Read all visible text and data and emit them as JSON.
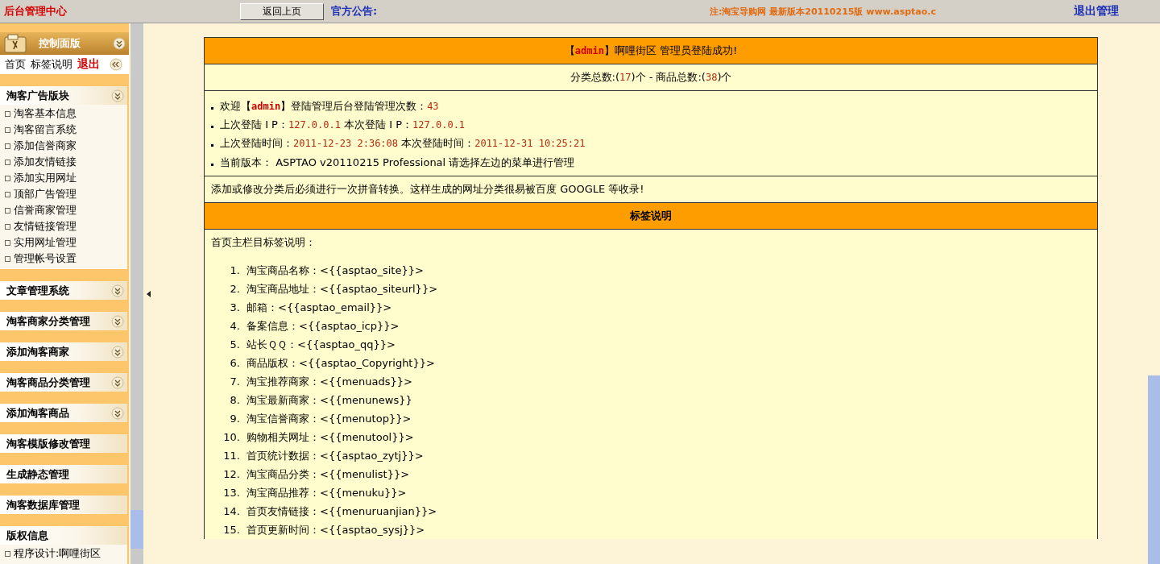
{
  "top_bar": {
    "title": "后台管理中心",
    "back_button": "返回上页",
    "notice_label": "官方公告:",
    "notice": "注:淘宝导购网 最新版本20110215版 www.asptao.c",
    "logout": "退出管理"
  },
  "sidebar": {
    "panel_title": "控制面版",
    "links": [
      {
        "label": "首页",
        "kind": "plain"
      },
      {
        "label": "标签说明",
        "kind": "plain"
      },
      {
        "label": "退出",
        "kind": "exit"
      }
    ],
    "sections": [
      {
        "title": "淘客广告版块",
        "kind": "menu",
        "items": [
          "淘客基本信息",
          "淘客留言系统",
          "添加信誉商家",
          "添加友情链接",
          "添加实用网址",
          "顶部广告管理",
          "信誉商家管理",
          "友情链接管理",
          "实用网址管理",
          "管理帐号设置"
        ]
      },
      {
        "title": "文章管理系统",
        "kind": "menu"
      },
      {
        "title": "淘客商家分类管理",
        "kind": "menu"
      },
      {
        "title": "添加淘客商家",
        "kind": "menu"
      },
      {
        "title": "淘客商品分类管理",
        "kind": "menu"
      },
      {
        "title": "添加淘客商品",
        "kind": "menu"
      },
      {
        "title": "淘客模版修改管理",
        "kind": "plain"
      },
      {
        "title": "生成静态管理",
        "kind": "plain"
      },
      {
        "title": "淘客数据库管理",
        "kind": "plain"
      },
      {
        "title": "版权信息",
        "kind": "plain",
        "items": [
          "程序设计:啊哩街区"
        ]
      }
    ]
  },
  "main": {
    "header": [
      {
        "text": "【",
        "kind": "plain"
      },
      {
        "text": "admin",
        "kind": "user"
      },
      {
        "text": "】啊哩街区 管理员登陆成功!",
        "kind": "plain"
      }
    ],
    "stats": [
      {
        "text": "分类总数:(",
        "kind": "plain"
      },
      {
        "text": "17",
        "kind": "value"
      },
      {
        "text": ")个 - 商品总数:(",
        "kind": "plain"
      },
      {
        "text": "38",
        "kind": "value"
      },
      {
        "text": ")个",
        "kind": "plain"
      }
    ],
    "info_lines": [
      [
        {
          "text": "欢迎【",
          "kind": "plain"
        },
        {
          "text": "admin",
          "kind": "user"
        },
        {
          "text": "】登陆管理后台登陆管理次数：",
          "kind": "plain"
        },
        {
          "text": "43",
          "kind": "value"
        }
      ],
      [
        {
          "text": "上次登陆 I P：",
          "kind": "plain"
        },
        {
          "text": "127.0.0.1",
          "kind": "value"
        },
        {
          "text": " 本次登陆 I P：",
          "kind": "plain"
        },
        {
          "text": "127.0.0.1",
          "kind": "value"
        }
      ],
      [
        {
          "text": "上次登陆时间：",
          "kind": "plain"
        },
        {
          "text": "2011-12-23 2:36:08",
          "kind": "value"
        },
        {
          "text": " 本次登陆时间：",
          "kind": "plain"
        },
        {
          "text": "2011-12-31 10:25:21",
          "kind": "value"
        }
      ],
      [
        {
          "text": "当前版本： ASPTAO v20110215 Professional 请选择左边的菜单进行管理",
          "kind": "plain"
        }
      ]
    ],
    "note": "添加或修改分类后必须进行一次拼音转换。这样生成的网址分类很易被百度 GOOGLE 等收录!",
    "tags_title": "标签说明",
    "tags_intro": "首页主栏目标签说明：",
    "tags": [
      {
        "num": "1.",
        "text": "淘宝商品名称：<{{asptao_site}}>"
      },
      {
        "num": "2.",
        "text": "淘宝商品地址：<{{asptao_siteurl}}>"
      },
      {
        "num": "3.",
        "text": "邮箱：<{{asptao_email}}>"
      },
      {
        "num": "4.",
        "text": "备案信息：<{{asptao_icp}}>"
      },
      {
        "num": "5.",
        "text": "站长ＱＱ：<{{asptao_qq}}>"
      },
      {
        "num": "6.",
        "text": "商品版权：<{{asptao_Copyright}}>"
      },
      {
        "num": "7.",
        "text": "淘宝推荐商家：<{{menuads}}>"
      },
      {
        "num": "8.",
        "text": "淘宝最新商家：<{{menunews}}"
      },
      {
        "num": "9.",
        "text": "淘宝信誉商家：<{{menutop}}>"
      },
      {
        "num": "10.",
        "text": "购物相关网址：<{{menutool}}>"
      },
      {
        "num": "11.",
        "text": "首页统计数据：<{{asptao_zytj}}>"
      },
      {
        "num": "12.",
        "text": "淘宝商品分类：<{{menulist}}>"
      },
      {
        "num": "13.",
        "text": "淘宝商品推荐：<{{menuku}}>"
      },
      {
        "num": "14.",
        "text": "首页友情链接：<{{menuruanjian}}>"
      },
      {
        "num": "15.",
        "text": "首页更新时间：<{{asptao_sysj}}>"
      }
    ]
  }
}
